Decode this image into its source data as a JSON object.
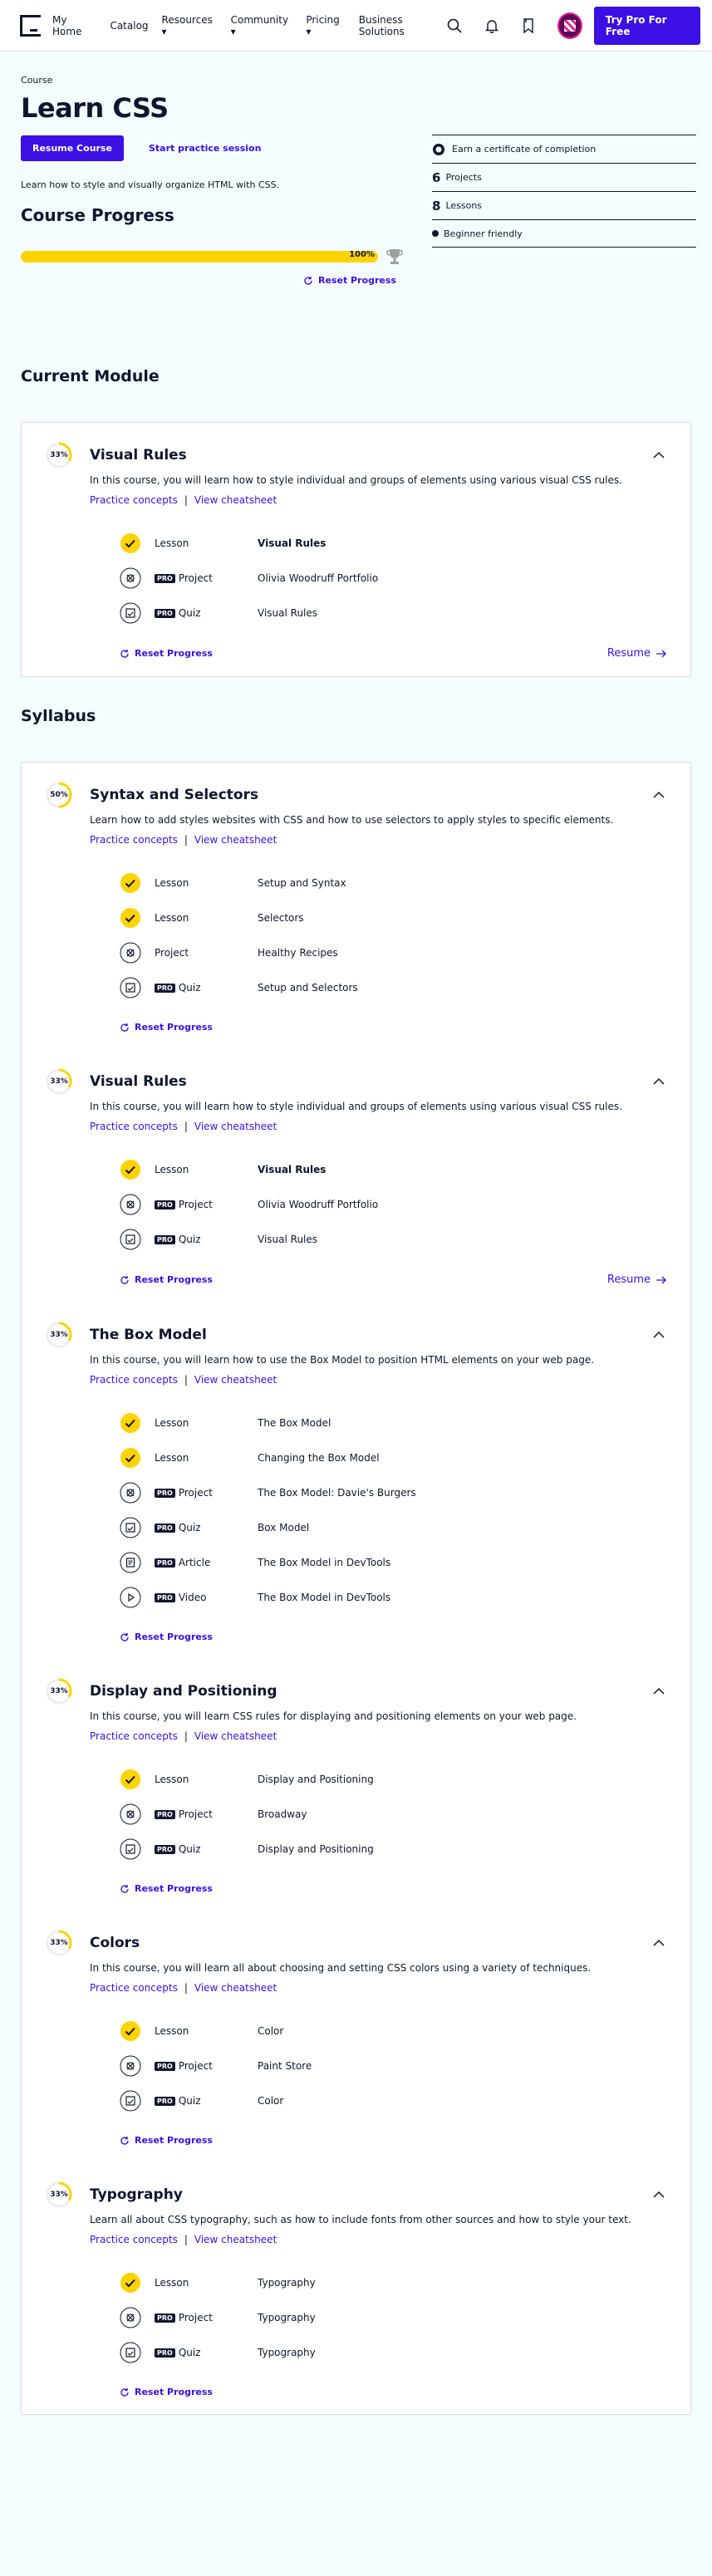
{
  "nav": {
    "items": [
      "My Home",
      "Catalog",
      "Resources",
      "Community",
      "Pricing",
      "Business Solutions"
    ],
    "cta": "Try Pro For Free"
  },
  "hero": {
    "breadcrumb": "Course",
    "title": "Learn CSS",
    "resume_button": "Resume Course",
    "practice_button": "Start practice session",
    "description": "Learn how to style and visually organize HTML with CSS.",
    "progress_title": "Course Progress",
    "progress_pct": "100%",
    "progress_fraction": 1.0,
    "reset_label": "Reset Progress"
  },
  "facts": {
    "certificate": "Earn a certificate of completion",
    "projects_count": "6",
    "projects_label": "Projects",
    "lessons_count": "8",
    "lessons_label": "Lessons",
    "level": "Beginner friendly"
  },
  "labels": {
    "current_module": "Current Module",
    "syllabus": "Syllabus",
    "practice": "Practice concepts",
    "sep": "|",
    "cheatsheet": "View cheatsheet",
    "reset": "Reset Progress",
    "resume": "Resume",
    "pro": "PRO"
  },
  "current_module": {
    "title": "Visual Rules",
    "pct": "33%",
    "fraction": 0.33,
    "description": "In this course, you will learn how to style individual and groups of elements using various visual CSS rules.",
    "resume": true,
    "items": [
      {
        "type": "Lesson",
        "name": "Visual Rules",
        "done": true,
        "pro": false,
        "current": true,
        "icon": "check"
      },
      {
        "type": "Project",
        "name": "Olivia Woodruff Portfolio",
        "done": false,
        "pro": true,
        "current": false,
        "icon": "project"
      },
      {
        "type": "Quiz",
        "name": "Visual Rules",
        "done": false,
        "pro": true,
        "current": false,
        "icon": "quiz"
      }
    ]
  },
  "syllabus": [
    {
      "title": "Syntax and Selectors",
      "pct": "50%",
      "fraction": 0.5,
      "description": "Learn how to add styles websites with CSS and how to use selectors to apply styles to specific elements.",
      "resume": false,
      "items": [
        {
          "type": "Lesson",
          "name": "Setup and Syntax",
          "done": true,
          "pro": false,
          "current": false,
          "icon": "check"
        },
        {
          "type": "Lesson",
          "name": "Selectors",
          "done": true,
          "pro": false,
          "current": false,
          "icon": "check"
        },
        {
          "type": "Project",
          "name": "Healthy Recipes",
          "done": false,
          "pro": false,
          "current": false,
          "icon": "project"
        },
        {
          "type": "Quiz",
          "name": "Setup and Selectors",
          "done": false,
          "pro": true,
          "current": false,
          "icon": "quiz"
        }
      ]
    },
    {
      "title": "Visual Rules",
      "pct": "33%",
      "fraction": 0.33,
      "description": "In this course, you will learn how to style individual and groups of elements using various visual CSS rules.",
      "resume": true,
      "items": [
        {
          "type": "Lesson",
          "name": "Visual Rules",
          "done": true,
          "pro": false,
          "current": true,
          "icon": "check"
        },
        {
          "type": "Project",
          "name": "Olivia Woodruff Portfolio",
          "done": false,
          "pro": true,
          "current": false,
          "icon": "project"
        },
        {
          "type": "Quiz",
          "name": "Visual Rules",
          "done": false,
          "pro": true,
          "current": false,
          "icon": "quiz"
        }
      ]
    },
    {
      "title": "The Box Model",
      "pct": "33%",
      "fraction": 0.33,
      "description": "In this course, you will learn how to use the Box Model to position HTML elements on your web page.",
      "resume": false,
      "items": [
        {
          "type": "Lesson",
          "name": "The Box Model",
          "done": true,
          "pro": false,
          "current": false,
          "icon": "check"
        },
        {
          "type": "Lesson",
          "name": "Changing the Box Model",
          "done": true,
          "pro": false,
          "current": false,
          "icon": "check"
        },
        {
          "type": "Project",
          "name": "The Box Model: Davie's Burgers",
          "done": false,
          "pro": true,
          "current": false,
          "icon": "project"
        },
        {
          "type": "Quiz",
          "name": "Box Model",
          "done": false,
          "pro": true,
          "current": false,
          "icon": "quiz"
        },
        {
          "type": "Article",
          "name": "The Box Model in DevTools",
          "done": false,
          "pro": true,
          "current": false,
          "icon": "article"
        },
        {
          "type": "Video",
          "name": "The Box Model in DevTools",
          "done": false,
          "pro": true,
          "current": false,
          "icon": "video"
        }
      ]
    },
    {
      "title": "Display and Positioning",
      "pct": "33%",
      "fraction": 0.33,
      "description": "In this course, you will learn CSS rules for displaying and positioning elements on your web page.",
      "resume": false,
      "items": [
        {
          "type": "Lesson",
          "name": "Display and Positioning",
          "done": true,
          "pro": false,
          "current": false,
          "icon": "check"
        },
        {
          "type": "Project",
          "name": "Broadway",
          "done": false,
          "pro": true,
          "current": false,
          "icon": "project"
        },
        {
          "type": "Quiz",
          "name": "Display and Positioning",
          "done": false,
          "pro": true,
          "current": false,
          "icon": "quiz"
        }
      ]
    },
    {
      "title": "Colors",
      "pct": "33%",
      "fraction": 0.33,
      "description": "In this course, you will learn all about choosing and setting CSS colors using a variety of techniques.",
      "resume": false,
      "items": [
        {
          "type": "Lesson",
          "name": "Color",
          "done": true,
          "pro": false,
          "current": false,
          "icon": "check"
        },
        {
          "type": "Project",
          "name": "Paint Store",
          "done": false,
          "pro": true,
          "current": false,
          "icon": "project"
        },
        {
          "type": "Quiz",
          "name": "Color",
          "done": false,
          "pro": true,
          "current": false,
          "icon": "quiz"
        }
      ]
    },
    {
      "title": "Typography",
      "pct": "33%",
      "fraction": 0.33,
      "description": "Learn all about CSS typography, such as how to include fonts from other sources and how to style your text.",
      "resume": false,
      "items": [
        {
          "type": "Lesson",
          "name": "Typography",
          "done": true,
          "pro": false,
          "current": false,
          "icon": "check"
        },
        {
          "type": "Project",
          "name": "Typography",
          "done": false,
          "pro": true,
          "current": false,
          "icon": "project"
        },
        {
          "type": "Quiz",
          "name": "Typography",
          "done": false,
          "pro": true,
          "current": false,
          "icon": "quiz"
        }
      ]
    }
  ],
  "colors": {
    "accent": "#3a10e5",
    "progress": "#ffd300",
    "ink": "#10162f",
    "background": "#f5fcff"
  }
}
